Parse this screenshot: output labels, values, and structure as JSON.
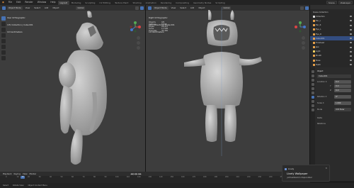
{
  "menu": [
    "File",
    "Edit",
    "Render",
    "Window",
    "Help"
  ],
  "workspaces": [
    "Layout",
    "Modeling",
    "Sculpting",
    "UV Editing",
    "Texture Paint",
    "Shading",
    "Animation",
    "Rendering",
    "Compositing",
    "Geometry Nodes",
    "Scripting"
  ],
  "active_workspace": "Layout",
  "top_right": {
    "scene": "Scene",
    "view_layer": "ViewLayer"
  },
  "left_viewport": {
    "header": {
      "mode": "Object Mode",
      "view": "View",
      "select": "Select",
      "add": "Add",
      "object": "Object",
      "transform": "Global"
    },
    "hud": [
      "User Orthographic",
      "(15) Collection | Cube.001",
      "10 Centimeters"
    ]
  },
  "right_viewport": {
    "header": {
      "mode": "Object Mode",
      "view": "View",
      "select": "Select",
      "add": "Add",
      "object": "Object",
      "transform": "Global"
    },
    "hud": [
      "Right Orthographic",
      "(15) Collection | Cube.001",
      "10 Centimeters"
    ],
    "stats": [
      {
        "k": "Objects",
        "v": "0/9"
      },
      {
        "k": "Vertices",
        "v": "8,848"
      },
      {
        "k": "Edges",
        "v": "26,411"
      },
      {
        "k": "Faces",
        "v": "17,599"
      },
      {
        "k": "Triangles",
        "v": "35,456"
      }
    ]
  },
  "outliner": {
    "items": [
      "Scene Collection",
      "Collection",
      "Ear_L",
      "Ear_R",
      "Eye_L",
      "Eye_R",
      "Cube.001",
      "Forehead",
      "Jaw",
      "Light",
      "Mouth",
      "Nose",
      "Teeth"
    ]
  },
  "properties": {
    "tabs": 10,
    "section": "Object",
    "fields": [
      {
        "label": "Location X",
        "value": "0 m"
      },
      {
        "label": "Y",
        "value": "0 m"
      },
      {
        "label": "Z",
        "value": "0 m"
      },
      {
        "label": "Rotation X",
        "value": "0°"
      },
      {
        "label": "Scale X",
        "value": "1.000"
      },
      {
        "label": "Mode",
        "value": "XYZ Euler"
      },
      {
        "label": "Delta",
        "value": ""
      },
      {
        "label": "Relations",
        "value": ""
      }
    ]
  },
  "timeline": {
    "header": [
      "Playback",
      "Keying",
      "View",
      "Marker"
    ],
    "ticks": [
      "0",
      "10",
      "20",
      "30",
      "40",
      "50",
      "60",
      "70",
      "80",
      "90",
      "100",
      "110",
      "120",
      "130",
      "140",
      "150",
      "160",
      "170",
      "180",
      "190",
      "200",
      "210",
      "220",
      "230",
      "240",
      "250"
    ],
    "current_frame": "15"
  },
  "status": [
    "Select",
    "Rotate View",
    "Object Context Menu"
  ],
  "notification": {
    "app": "Lively",
    "title": "Lively Wallpaper",
    "body": "¡Actualización disponible!"
  },
  "colors": {
    "accent": "#4772b3",
    "viewport_bg": "#3d3d3d",
    "model": "#bdbdbd"
  }
}
